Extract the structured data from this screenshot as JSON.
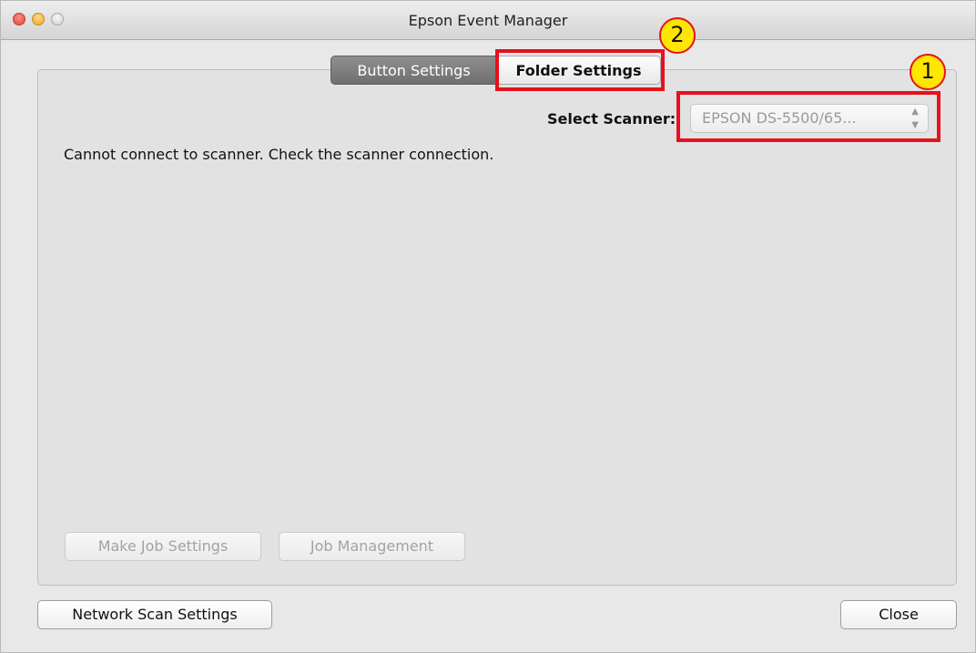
{
  "window": {
    "title": "Epson Event Manager"
  },
  "tabs": [
    {
      "label": "Button Settings"
    },
    {
      "label": "Folder Settings"
    }
  ],
  "scanner": {
    "label": "Select Scanner:",
    "value": "EPSON DS-5500/65..."
  },
  "message": "Cannot connect to scanner. Check the scanner connection.",
  "panel_buttons": {
    "make_job": "Make Job Settings",
    "job_management": "Job Management"
  },
  "footer": {
    "network_scan": "Network Scan Settings",
    "close": "Close"
  },
  "callouts": {
    "one": "1",
    "two": "2"
  },
  "colors": {
    "callout_border": "#e6111e",
    "callout_fill": "#ffe600"
  }
}
